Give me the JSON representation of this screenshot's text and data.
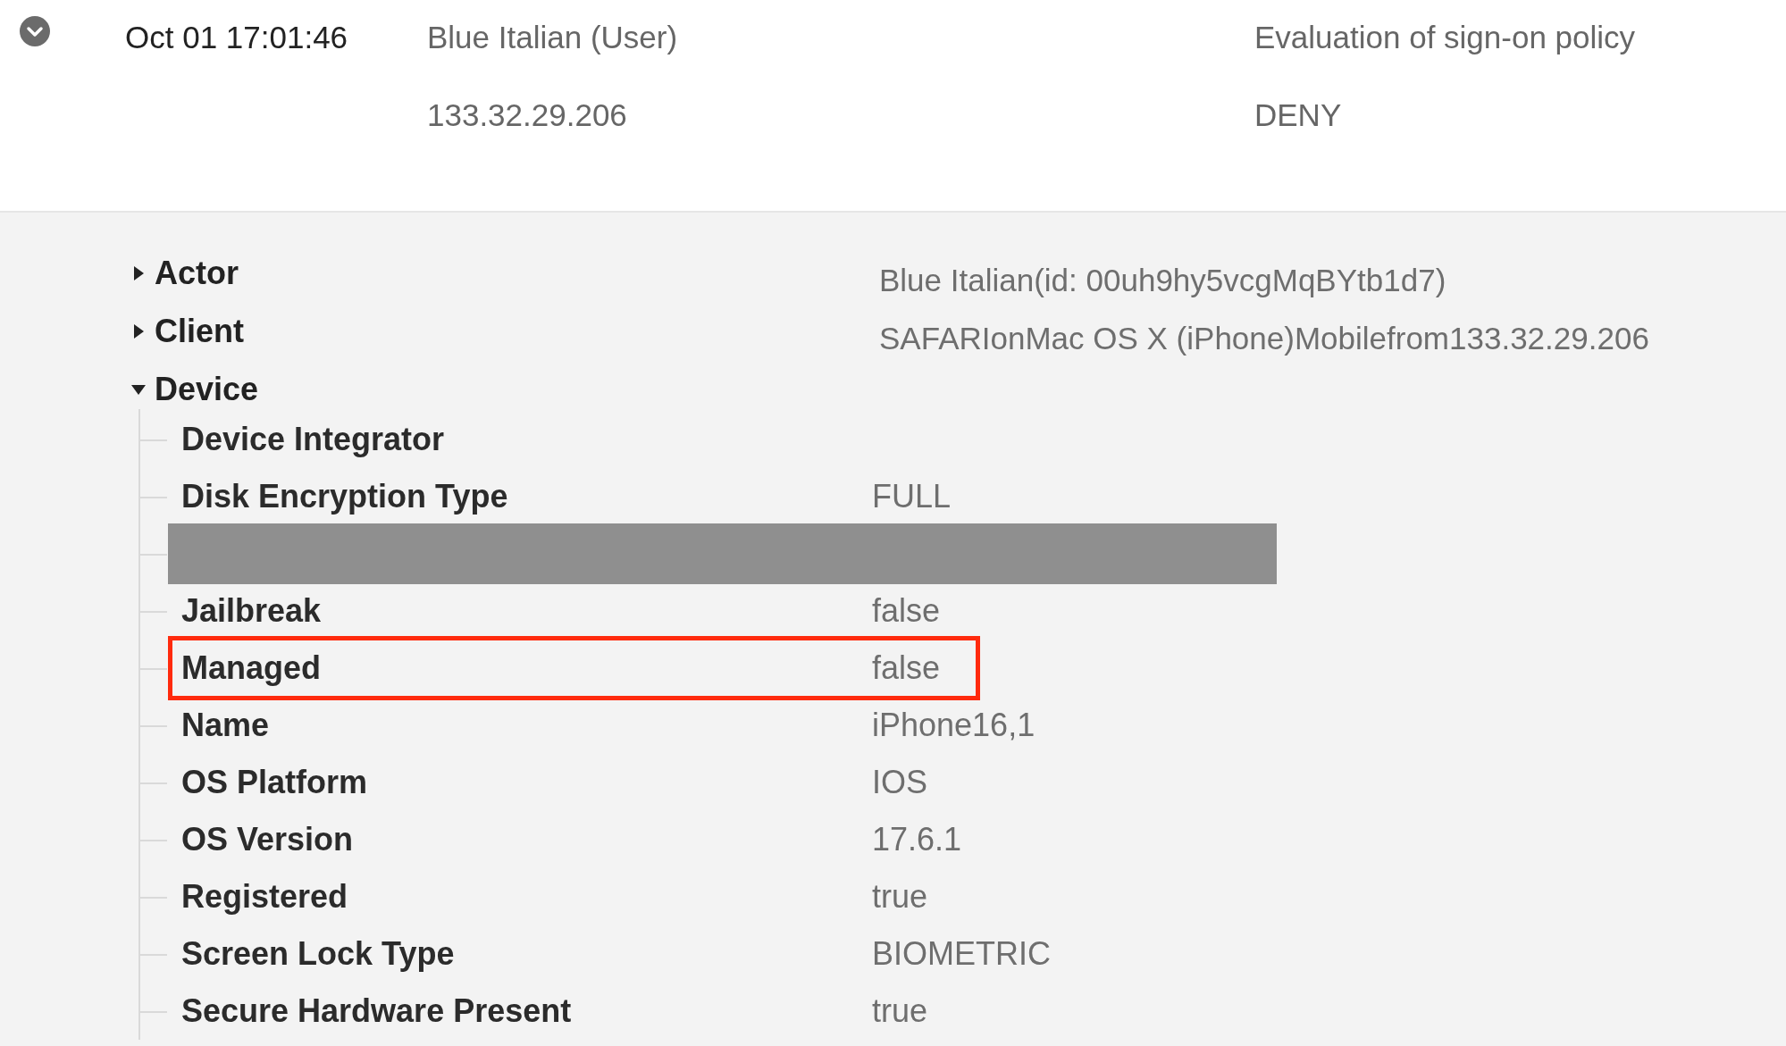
{
  "event": {
    "expanded": true,
    "time": "Oct 01 17:01:46",
    "actor": "Blue Italian (User)",
    "ip": "133.32.29.206",
    "action": "Evaluation of sign-on policy",
    "result": "DENY"
  },
  "details": [
    {
      "label": "Actor",
      "value": "Blue Italian(id: 00uh9hy5vcgMqBYtb1d7)",
      "expanded": false
    },
    {
      "label": "Client",
      "value": "SAFARIonMac OS X (iPhone)Mobilefrom133.32.29.206",
      "expanded": false
    },
    {
      "label": "Device",
      "expanded": true,
      "children": [
        {
          "kind": "field",
          "label": "Device Integrator",
          "highlighted": false
        },
        {
          "kind": "field",
          "label": "Disk Encryption Type",
          "value": "FULL",
          "highlighted": false
        },
        {
          "kind": "redacted"
        },
        {
          "kind": "field",
          "label": "Jailbreak",
          "value": "false",
          "highlighted": false
        },
        {
          "kind": "field",
          "label": "Managed",
          "value": "false",
          "highlighted": true
        },
        {
          "kind": "field",
          "label": "Name",
          "value": "iPhone16,1",
          "highlighted": false
        },
        {
          "kind": "field",
          "label": "OS Platform",
          "value": "IOS",
          "highlighted": false
        },
        {
          "kind": "field",
          "label": "OS Version",
          "value": "17.6.1",
          "highlighted": false
        },
        {
          "kind": "field",
          "label": "Registered",
          "value": "true",
          "highlighted": false
        },
        {
          "kind": "field",
          "label": "Screen Lock Type",
          "value": "BIOMETRIC",
          "highlighted": false
        },
        {
          "kind": "field",
          "label": "Secure Hardware Present",
          "value": "true",
          "highlighted": false
        }
      ]
    }
  ]
}
